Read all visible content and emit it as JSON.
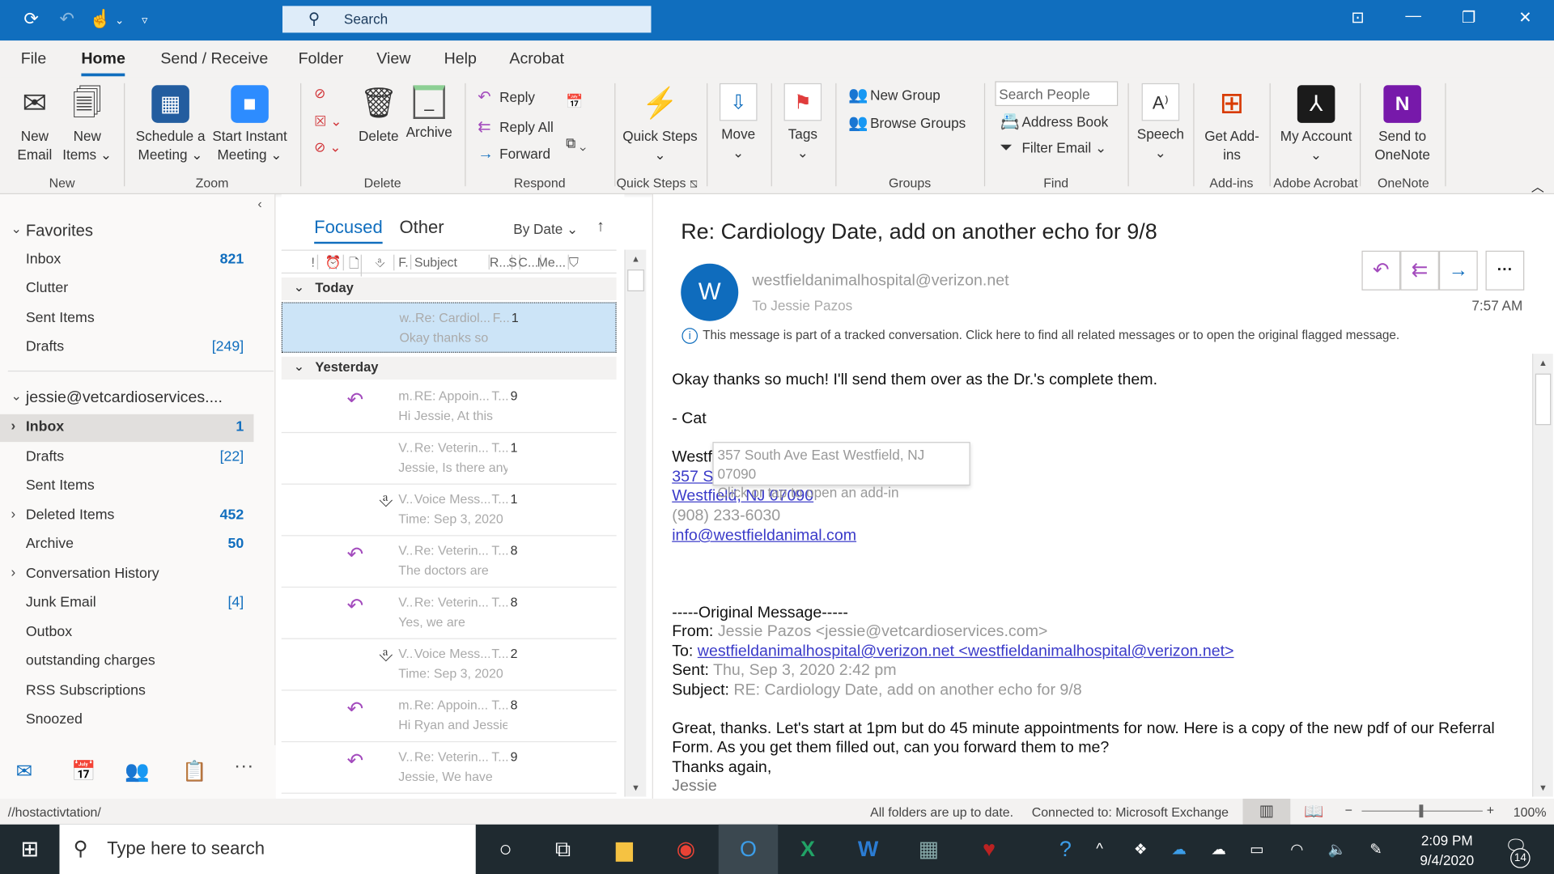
{
  "titlebar": {
    "search_placeholder": "Search",
    "icons": [
      "sync-icon",
      "undo-icon",
      "touch-mode-icon",
      "customize-qat-icon"
    ]
  },
  "menu": {
    "tabs": [
      "File",
      "Home",
      "Send / Receive",
      "Folder",
      "View",
      "Help",
      "Acrobat"
    ],
    "active": "Home"
  },
  "ribbon": {
    "new_email": "New Email",
    "new_items": "New Items",
    "schedule_meeting": "Schedule a Meeting",
    "start_instant": "Start Instant Meeting",
    "delete": "Delete",
    "archive": "Archive",
    "reply": "Reply",
    "reply_all": "Reply All",
    "forward": "Forward",
    "quick_steps": "Quick Steps",
    "move": "Move",
    "tags": "Tags",
    "new_group": "New Group",
    "browse_groups": "Browse Groups",
    "search_people_placeholder": "Search People",
    "address_book": "Address Book",
    "filter_email": "Filter Email",
    "speech": "Speech",
    "get_addins": "Get Add-ins",
    "my_account": "My Account",
    "send_onenote": "Send to OneNote",
    "groups": {
      "new": "New",
      "zoom": "Zoom",
      "delete": "Delete",
      "respond": "Respond",
      "quick_steps": "Quick Steps",
      "groups": "Groups",
      "find": "Find",
      "addins": "Add-ins",
      "acrobat": "Adobe Acrobat",
      "onenote": "OneNote"
    }
  },
  "nav": {
    "favorites_label": "Favorites",
    "favorites": [
      {
        "label": "Inbox",
        "count": "821"
      },
      {
        "label": "Clutter",
        "count": ""
      },
      {
        "label": "Sent Items",
        "count": ""
      },
      {
        "label": "Drafts",
        "count": "[249]"
      }
    ],
    "account": "jessie@vetcardioservices....",
    "folders": [
      {
        "label": "Inbox",
        "count": "1"
      },
      {
        "label": "Drafts",
        "count": "[22]"
      },
      {
        "label": "Sent Items",
        "count": ""
      },
      {
        "label": "Deleted Items",
        "count": "452"
      },
      {
        "label": "Archive",
        "count": "50"
      },
      {
        "label": "Conversation History",
        "count": ""
      },
      {
        "label": "Junk Email",
        "count": "[4]"
      },
      {
        "label": "Outbox",
        "count": ""
      },
      {
        "label": "outstanding charges",
        "count": ""
      },
      {
        "label": "RSS Subscriptions",
        "count": ""
      },
      {
        "label": "Snoozed",
        "count": ""
      }
    ]
  },
  "list": {
    "tabs": [
      "Focused",
      "Other"
    ],
    "sort": "By Date",
    "columns": [
      "!",
      "F.",
      "Subject",
      "R...",
      "S",
      "C...",
      "Me..."
    ],
    "groups": [
      "Today",
      "Yesterday"
    ],
    "today": [
      {
        "icon": "",
        "from": "w...",
        "subject": "Re: Cardiol...",
        "flag": "F...",
        "size": "1",
        "preview": "Okay thanks so"
      }
    ],
    "yesterday": [
      {
        "icon": "reply",
        "from": "m...",
        "subject": "RE: Appoin...",
        "flag": "T...",
        "size": "9",
        "preview": "Hi Jessie,  At this"
      },
      {
        "icon": "",
        "from": "V...",
        "subject": "Re: Veterin...",
        "flag": "T...",
        "size": "1",
        "preview": "Jessie,  Is there any"
      },
      {
        "icon": "attach",
        "from": "V...",
        "subject": "Voice Mess...",
        "flag": "T...",
        "size": "1",
        "preview": "Time: Sep 3, 2020"
      },
      {
        "icon": "reply",
        "from": "V...",
        "subject": "Re: Veterin...",
        "flag": "T...",
        "size": "8",
        "preview": "The doctors are"
      },
      {
        "icon": "reply",
        "from": "V...",
        "subject": "Re: Veterin...",
        "flag": "T...",
        "size": "8",
        "preview": "Yes, we are"
      },
      {
        "icon": "attach",
        "from": "V...",
        "subject": "Voice Mess...",
        "flag": "T...",
        "size": "2",
        "preview": "Time: Sep 3, 2020"
      },
      {
        "icon": "reply",
        "from": "m...",
        "subject": "Re: Appoin...",
        "flag": "T...",
        "size": "8",
        "preview": "Hi Ryan and Jessie,"
      },
      {
        "icon": "reply",
        "from": "V...",
        "subject": "Re: Veterin...",
        "flag": "T...",
        "size": "9",
        "preview": "Jessie,  We have"
      }
    ]
  },
  "reading": {
    "subject": "Re: Cardiology Date, add on another echo for 9/8",
    "avatar": "W",
    "from": "westfieldanimalhospital@verizon.net",
    "to": "To   Jessie Pazos",
    "time": "7:57 AM",
    "info": "This message is part of a tracked conversation. Click here to find all related messages or to open the original flagged message.",
    "body": {
      "l1": "Okay thanks so much! I'll send them over as the Dr.'s complete them.",
      "l2": "- Cat",
      "sig1": "Westf",
      "sig2": "357 S",
      "sig3": "Westfield, NJ 07090",
      "sig4": "(908) 233-6030",
      "sig5": "info@westfieldanimal.com",
      "tooltip1": "357 South Ave East Westfield, NJ 07090",
      "tooltip2": "Click or tap to open an add-in",
      "orig": "-----Original Message-----",
      "from_label": "From:",
      "from_val": "Jessie Pazos <jessie@vetcardioservices.com>",
      "to_label": "To:",
      "to_val": "westfieldanimalhospital@verizon.net <westfieldanimalhospital@verizon.net>",
      "sent_label": "Sent:",
      "sent_val": "Thu, Sep 3, 2020 2:42 pm",
      "subj_label": "Subject:",
      "subj_val": "RE: Cardiology Date, add on another echo for 9/8",
      "p1": "Great, thanks. Let's start at 1pm but do 45 minute appointments for now. Here is a copy of the new pdf of our Referral",
      "p2": "Form. As you get them filled out, can you forward them to me?",
      "p3": "Thanks again,",
      "p4": "Jessie"
    }
  },
  "status": {
    "left": "//hostactivtation/",
    "sync": "All folders are up to date.",
    "connection": "Connected to: Microsoft Exchange",
    "zoom": "100%"
  },
  "taskbar": {
    "search": "Type here to search",
    "time": "2:09 PM",
    "date": "9/4/2020",
    "notifications": "14"
  },
  "colors": {
    "accent": "#106ebe",
    "reply_icon": "#a34bbd",
    "selected": "#cce4f7"
  }
}
